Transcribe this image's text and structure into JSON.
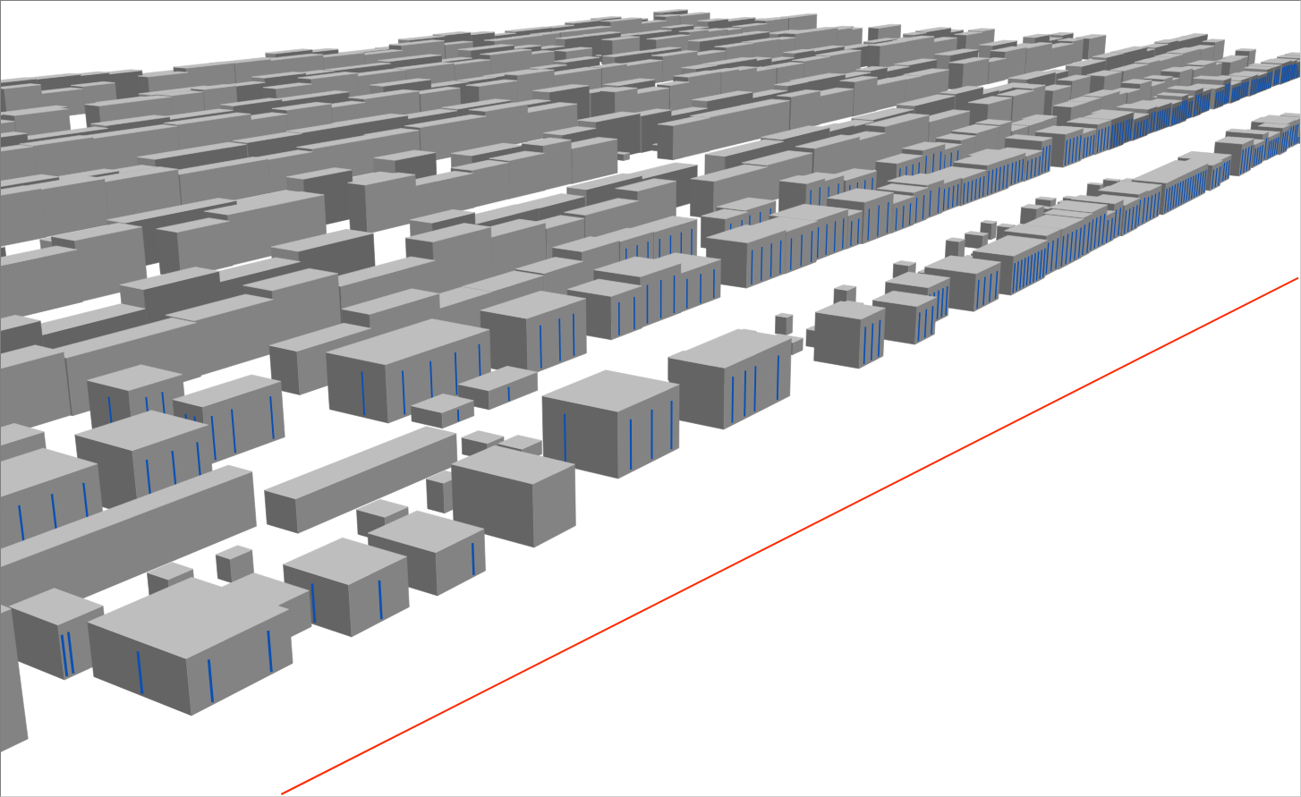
{
  "scene": {
    "kind": "city_3d",
    "layers": [
      {
        "kind": "buildings"
      },
      {
        "kind": "facade_lines"
      },
      {
        "kind": "route_line"
      }
    ]
  }
}
